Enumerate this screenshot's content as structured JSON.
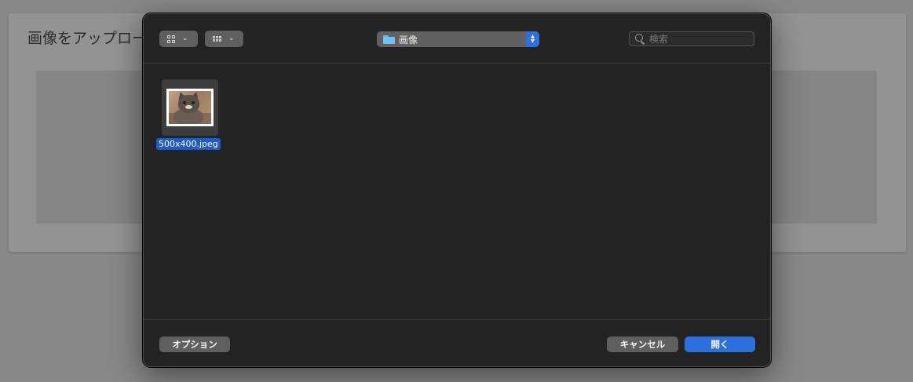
{
  "background": {
    "title": "画像をアップロード"
  },
  "dialog": {
    "toolbar": {
      "view_icon": "icon-grid-view-icon",
      "group_icon": "group-grid-icon",
      "location": {
        "label": "画像",
        "icon": "folder-icon"
      },
      "search": {
        "placeholder": "検索",
        "value": ""
      }
    },
    "files": [
      {
        "name": "500x400.jpeg",
        "selected": true,
        "thumbnail": "kitten-photo"
      }
    ],
    "footer": {
      "options_label": "オプション",
      "cancel_label": "キャンセル",
      "open_label": "開く"
    }
  },
  "colors": {
    "dialog_bg": "#232323",
    "accent": "#2e6fde",
    "selection": "#1e5bd0",
    "folder": "#6ec2f7"
  }
}
